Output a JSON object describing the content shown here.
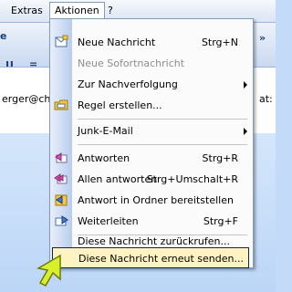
{
  "menubar": {
    "extras": "Extras",
    "aktionen": "Aktionen",
    "help": "?"
  },
  "background": {
    "left_text": "erger@chel",
    "right_text": "at:"
  },
  "menu": {
    "items": [
      {
        "label": "Neue Nachricht",
        "shortcut": "Strg+N",
        "icon": "new-message-icon",
        "enabled": true
      },
      {
        "label": "Neue Sofortnachricht",
        "shortcut": "",
        "icon": "",
        "enabled": false
      },
      {
        "label": "Zur Nachverfolgung",
        "shortcut": "",
        "icon": "",
        "enabled": true,
        "submenu": true
      },
      {
        "label": "Regel erstellen...",
        "shortcut": "",
        "icon": "rule-folder-icon",
        "enabled": true
      },
      {
        "label": "Junk-E-Mail",
        "shortcut": "",
        "icon": "",
        "enabled": true,
        "submenu": true
      },
      {
        "label": "Antworten",
        "shortcut": "Strg+R",
        "icon": "reply-icon",
        "enabled": true
      },
      {
        "label": "Allen antworten",
        "shortcut": "Strg+Umschalt+R",
        "icon": "reply-all-icon",
        "enabled": true
      },
      {
        "label": "Antwort in Ordner bereitstellen",
        "shortcut": "",
        "icon": "post-reply-icon",
        "enabled": true
      },
      {
        "label": "Weiterleiten",
        "shortcut": "Strg+F",
        "icon": "forward-icon",
        "enabled": true
      },
      {
        "label": "Diese Nachricht zurückrufen...",
        "shortcut": "",
        "icon": "",
        "enabled": true
      },
      {
        "label": "Diese Nachricht erneut senden...",
        "shortcut": "",
        "icon": "",
        "enabled": true,
        "highlighted": true
      }
    ]
  },
  "colors": {
    "menu_highlight": "#fff3c3",
    "menu_border": "#0a246a",
    "pointer": "#d8f02a"
  }
}
